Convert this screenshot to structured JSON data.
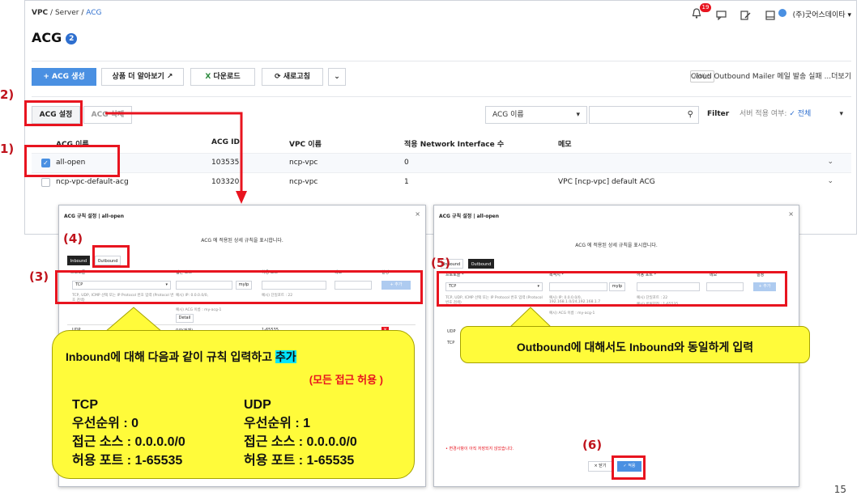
{
  "console": {
    "breadcrumb": {
      "vpc": "VPC",
      "sep1": " / ",
      "server": "Server",
      "sep2": " / ",
      "acg": "ACG"
    },
    "title": "ACG",
    "title_badge": "2",
    "header_right": {
      "notif_count": "19",
      "account": "(주)굿어스데이타 ▾"
    },
    "toolbar": {
      "create_label": "+ ACG 생성",
      "more_info_label": "상품 더 알아보기 ↗",
      "download_label": "다운로드",
      "refresh_label": "새로고침",
      "more_label": "⌄"
    },
    "service_tag": "서비스",
    "service_notice": "Cloud Outbound Mailer 메일 발송 실패 ...더보기",
    "actions": {
      "settings_label": "ACG 설정",
      "delete_label": "ACG 삭제"
    },
    "filter": {
      "field_select": "ACG 이름",
      "search_placeholder": "",
      "filter_label": "Filter",
      "server_apply_label": "서버 적용 여부:",
      "server_apply_value": "✓ 전체"
    },
    "table": {
      "headers": [
        "ACG 이름",
        "ACG ID",
        "VPC 이름",
        "적용 Network Interface 수",
        "메모"
      ],
      "rows": [
        {
          "name": "all-open",
          "id": "103535",
          "vpc": "ncp-vpc",
          "count": "0",
          "memo": "",
          "checked": true
        },
        {
          "name": "ncp-vpc-default-acg",
          "id": "103320",
          "vpc": "ncp-vpc",
          "count": "1",
          "memo": "VPC [ncp-vpc] default ACG",
          "checked": false
        }
      ]
    }
  },
  "dialog_in": {
    "title": "ACG 규칙 설정 | all-open",
    "desc": "ACG 에 적용된 상세 규칙을 표시합니다.",
    "tab_inbound": "Inbound",
    "tab_outbound": "Outbound",
    "col_protocol": "프로토콜 *",
    "col_source": "접근 소스 *",
    "col_port": "허용 포트 *",
    "col_memo": "메모",
    "col_setting": "설정",
    "protocol_value": "TCP",
    "myip_label": "myIp",
    "add_label": "+ 추가",
    "hint_protocol": "TCP, UDP, ICMP 선택 또는 IP Protocol 번호 입력 (Protocol 번호 검색)",
    "hint_source": "예시) IP: 0.0.0.0/0,",
    "hint_source2": "예시) ACG 이름 : my-acg-1",
    "hint_port": "예시) 단일포트 : 22",
    "detail_label": "Detail",
    "rule_row_protocol": "UDP",
    "rule_row_port": "1-65535",
    "rule_row_source": "0/0(전체)"
  },
  "dialog_out": {
    "title": "ACG 규칙 설정 | all-open",
    "desc": "ACG 에 적용된 상세 규칙을 표시합니다.",
    "tab_inbound": "Inbound",
    "tab_outbound": "Outbound",
    "col_protocol": "프로토콜 *",
    "col_target": "목적지 *",
    "col_port": "허용 포트 *",
    "col_memo": "메모",
    "col_setting": "설정",
    "protocol_value": "TCP",
    "myip_label": "myIp",
    "add_label": "+ 추가",
    "hint_protocol": "TCP, UDP, ICMP 선택 또는 IP Protocol 번호 입력 (Protocol 번호 검색)",
    "hint_target": "예시) IP: 0.0.0.0/0, 192.168.1.0/24,192.168.1.7",
    "hint_target2": "예시) ACG 이름 : my-acg-1",
    "hint_port": "예시) 단일포트 : 22",
    "hint_port2": "예시) 범위지정 : 1-65535",
    "row1": "UDP",
    "row2": "TCP",
    "unsaved": "• 변경사항이 아직 저장되지 않았습니다.",
    "close_label": "× 닫기",
    "apply_label": "✓ 적용"
  },
  "annotations": {
    "step1": "1)",
    "step2": "2)",
    "step3": "(3)",
    "step4": "(4)",
    "step5": "(5)",
    "step6": "(6)",
    "callout_in_main": "Inbound에 대해 다음과 같이 규칙 입력하고 ",
    "callout_in_highlight": "추가",
    "callout_in_sub": "(모든 접근 허용 )",
    "tcp_title": "TCP",
    "tcp_priority": "우선순위 : 0",
    "tcp_source": "접근 소스 : 0.0.0.0/0",
    "tcp_port": "허용 포트 : 1-65535",
    "udp_title": "UDP",
    "udp_priority": "우선순위 : 1",
    "udp_source": "접근 소스 : 0.0.0.0/0",
    "udp_port": "허용 포트 : 1-65535",
    "callout_out": "Outbound에 대해서도 Inbound와 동일하게 입력"
  },
  "page_number": "15",
  "colors": {
    "accent": "#4a90e2",
    "annotation_red": "#e8141f",
    "callout_yellow": "#fffb3a",
    "highlight_cyan": "#00e5ff"
  }
}
